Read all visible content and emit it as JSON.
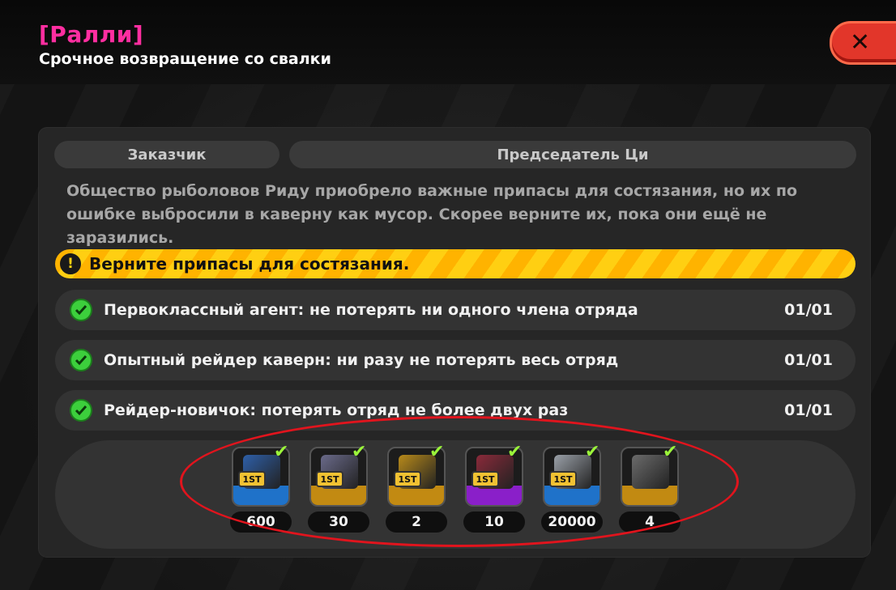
{
  "header": {
    "event_tag": "[Ралли]",
    "subtitle": "Срочное возвращение со свалки",
    "close_label": "✕"
  },
  "client": {
    "label": "Заказчик",
    "name": "Председатель Ци"
  },
  "description": "Общество рыболовов Риду приобрело важные припасы для состязания, но их по ошибке выбросили в каверну как мусор. Скорее верните их, пока они ещё не заразились.",
  "objective": {
    "icon": "exclamation-icon",
    "text": "Верните припасы для состязания."
  },
  "tasks": [
    {
      "label": "Первоклассный агент: не потерять ни одного члена отряда",
      "progress": "01/01",
      "completed": true
    },
    {
      "label": "Опытный рейдер каверн: ни разу не потерять весь отряд",
      "progress": "01/01",
      "completed": true
    },
    {
      "label": "Рейдер-новичок: потерять отряд не более двух раз",
      "progress": "01/01",
      "completed": true
    }
  ],
  "rewards": [
    {
      "icon": "blueprint-icon",
      "badge": "1ST",
      "qty": "600",
      "rarity_color": "#1f72c9",
      "art_color": "#2e5fa8",
      "claimed": true
    },
    {
      "icon": "crate-icon",
      "badge": "1ST",
      "qty": "30",
      "rarity_color": "#c28a12",
      "art_color": "#6a6a8a",
      "claimed": true
    },
    {
      "icon": "cannon-icon",
      "badge": "1ST",
      "qty": "2",
      "rarity_color": "#c28a12",
      "art_color": "#b88a1a",
      "claimed": true
    },
    {
      "icon": "disc-icon",
      "badge": "1ST",
      "qty": "10",
      "rarity_color": "#8a1fc9",
      "art_color": "#8a2a3a",
      "claimed": true
    },
    {
      "icon": "gear-coin-icon",
      "badge": "1ST",
      "qty": "20000",
      "rarity_color": "#1f72c9",
      "art_color": "#9aa0a8",
      "claimed": true
    },
    {
      "icon": "supply-box-icon",
      "badge": "",
      "qty": "4",
      "rarity_color": "#c28a12",
      "art_color": "#6b6b6b",
      "claimed": true
    }
  ],
  "colors": {
    "accent_pink": "#ff2ea0",
    "objective_yellow": "#ffcf12",
    "check_green": "#3ccf3c",
    "close_red": "#e2362a",
    "annotation_red": "#e1141d"
  }
}
